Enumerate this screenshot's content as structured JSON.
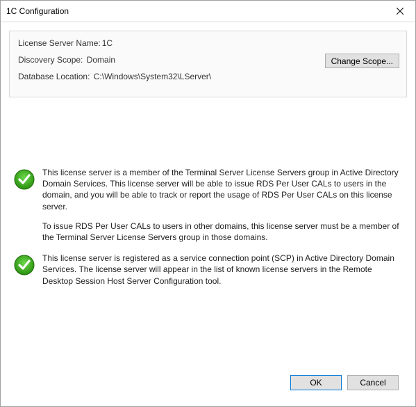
{
  "window": {
    "title": "1C Configuration"
  },
  "info": {
    "serverNameLabel": "License Server Name:",
    "serverNameValue": "1C",
    "scopeLabel": "Discovery Scope:",
    "scopeValue": "Domain",
    "dbLabel": "Database Location:",
    "dbValue": "C:\\Windows\\System32\\LServer\\",
    "changeScopeLabel": "Change Scope..."
  },
  "messages": {
    "group_p1": "This license server is a member of the Terminal Server License Servers group in Active Directory Domain Services. This license server will be able to issue RDS Per User CALs to users in the domain, and you will be able to track or report the usage of RDS Per User CALs on this license server.",
    "group_p2": "To issue RDS Per User CALs to users in other domains, this license server must be a member of the Terminal Server License Servers group in those domains.",
    "scp": "This license server is registered as a service connection point (SCP) in Active Directory Domain Services. The license server will appear in the list of known license servers in the Remote Desktop Session Host Server Configuration tool."
  },
  "footer": {
    "ok": "OK",
    "cancel": "Cancel"
  }
}
